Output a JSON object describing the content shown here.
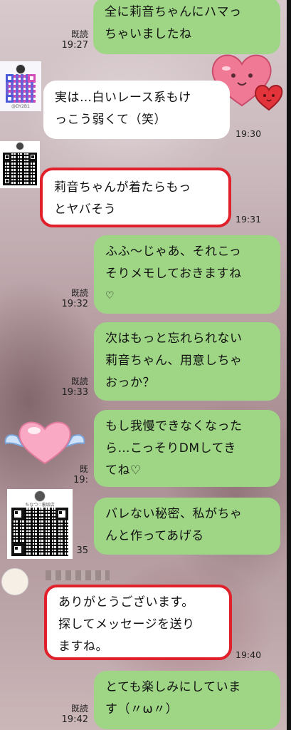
{
  "messages": [
    {
      "id": "m1",
      "side": "mine",
      "lines": [
        "全に莉音ちゃんにハマっ",
        "ちゃいましたね"
      ],
      "read": "既読",
      "time": "19:27"
    },
    {
      "id": "m2",
      "side": "theirs",
      "lines": [
        "実は…白いレース系もけ",
        "っこう弱くて（笑）"
      ],
      "time": "19:30"
    },
    {
      "id": "m3",
      "side": "theirs",
      "lines": [
        "莉音ちゃんが着たらもっ",
        "とヤバそう"
      ],
      "time": "19:31",
      "highlighted": true
    },
    {
      "id": "m4",
      "side": "mine",
      "lines": [
        "ふふ～じゃあ、それこっ",
        "そりメモしておきますね",
        "♡"
      ],
      "read": "既読",
      "time": "19:32"
    },
    {
      "id": "m5",
      "side": "mine",
      "lines": [
        "次はもっと忘れられない",
        "莉音ちゃん、用意しちゃ",
        "おっか？"
      ],
      "read": "既読",
      "time": "19:33"
    },
    {
      "id": "m6",
      "side": "mine",
      "lines": [
        "もし我慢できなくなった",
        "ら…こっそりDMしてき",
        "てね♡"
      ],
      "read": "既",
      "time": "19:"
    },
    {
      "id": "m7",
      "side": "mine",
      "lines": [
        "バレない秘密、私がちゃ",
        "んと作ってあげる"
      ],
      "read": "",
      "time": "35"
    },
    {
      "id": "m8",
      "side": "theirs",
      "lines": [
        "ありがとうございます。",
        "探してメッセージを送り",
        "ますね。"
      ],
      "time": "19:40",
      "highlighted": true
    },
    {
      "id": "m9",
      "side": "mine",
      "lines": [
        "とても楽しみにしていま",
        "す（〃ω〃）"
      ],
      "read": "既読",
      "time": "19:42"
    }
  ],
  "qr_captions": {
    "small_top": "@DY2B1",
    "large": "ちなつ♡裏垢店"
  },
  "colors": {
    "mine_bubble": "#9fd685",
    "theirs_bubble": "#ffffff",
    "highlight": "#e0202a"
  },
  "stickers": {
    "top_heart": "pink-heart-face-sticker",
    "winged_heart": "winged-heart-sticker"
  }
}
